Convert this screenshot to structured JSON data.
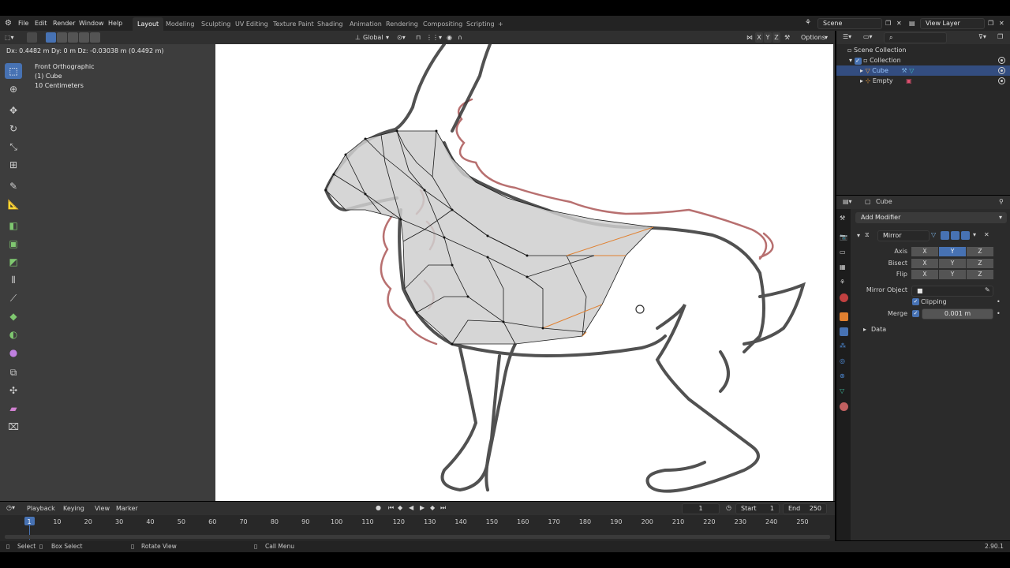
{
  "menu": [
    "File",
    "Edit",
    "Render",
    "Window",
    "Help"
  ],
  "workspaces": [
    "Layout",
    "Modeling",
    "Sculpting",
    "UV Editing",
    "Texture Paint",
    "Shading",
    "Animation",
    "Rendering",
    "Compositing",
    "Scripting",
    "+"
  ],
  "active_workspace": "Layout",
  "scene": "Scene",
  "view_layer": "View Layer",
  "viewport_header": {
    "orientation": "Global",
    "axes": [
      "X",
      "Y",
      "Z"
    ],
    "options": "Options"
  },
  "drag_status": "Dx: 0.4482 m   Dy: 0 m   Dz: -0.03038 m (0.4492 m)",
  "viewport_info": {
    "view": "Front Orthographic",
    "object": "(1) Cube",
    "scale": "10 Centimeters"
  },
  "outliner": {
    "root": "Scene Collection",
    "collection": "Collection",
    "items": [
      "Cube",
      "Empty"
    ]
  },
  "properties": {
    "object_name": "Cube",
    "add_modifier": "Add Modifier",
    "modifier_name": "Mirror",
    "rows": [
      {
        "label": "Axis",
        "x": "X",
        "y": "Y",
        "z": "Z"
      },
      {
        "label": "Bisect",
        "x": "X",
        "y": "Y",
        "z": "Z"
      },
      {
        "label": "Flip",
        "x": "X",
        "y": "Y",
        "z": "Z"
      }
    ],
    "mirror_object_label": "Mirror Object",
    "clipping_label": "Clipping",
    "merge_label": "Merge",
    "merge_value": "0.001 m",
    "data_panel": "Data"
  },
  "timeline": {
    "menus": [
      "Playback",
      "Keying",
      "View",
      "Marker"
    ],
    "current_frame": "1",
    "start_label": "Start",
    "start": "1",
    "end_label": "End",
    "end": "250",
    "ticks": [
      "1",
      "10",
      "20",
      "30",
      "40",
      "50",
      "60",
      "70",
      "80",
      "90",
      "100",
      "110",
      "120",
      "130",
      "140",
      "150",
      "160",
      "170",
      "180",
      "190",
      "200",
      "210",
      "220",
      "230",
      "240",
      "250"
    ]
  },
  "statusbar": {
    "select": "Select",
    "box_select": "Box Select",
    "rotate_view": "Rotate View",
    "call_menu": "Call Menu",
    "version": "2.90.1"
  },
  "colors": {
    "accent": "#4772b3",
    "selection": "#334d80",
    "sketch_red": "#a04040",
    "edge_orange": "#e08030"
  }
}
